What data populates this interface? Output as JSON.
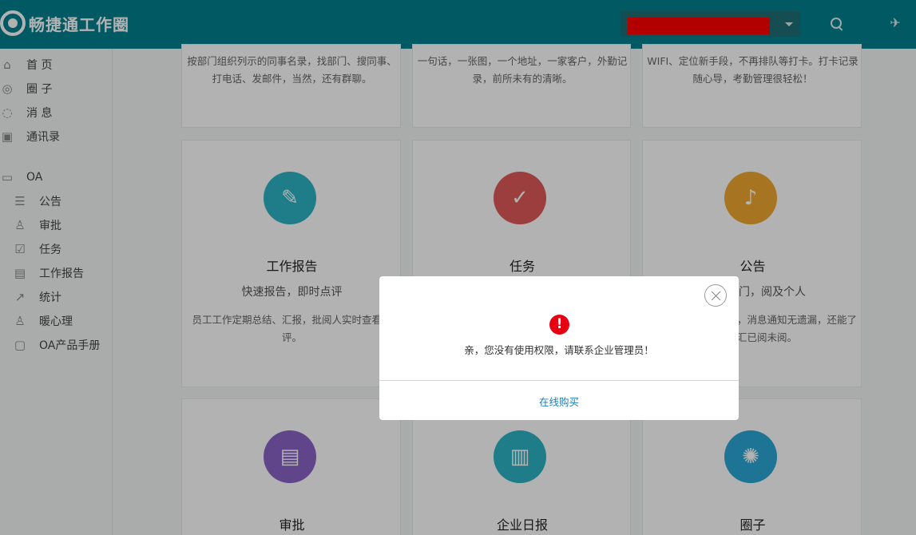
{
  "header": {
    "app_name": "畅捷通工作圈",
    "search_icon": "search-icon",
    "send_icon": "paper-plane-icon"
  },
  "sidebar": {
    "main": [
      {
        "label": "首 页",
        "icon": "home-icon"
      },
      {
        "label": "圈 子",
        "icon": "circle-icon"
      },
      {
        "label": "消 息",
        "icon": "chat-icon"
      },
      {
        "label": "通讯录",
        "icon": "contacts-icon"
      }
    ],
    "section": {
      "label": "OA",
      "icon": "monitor-icon"
    },
    "sub": [
      {
        "label": "公告",
        "icon": "announcement-icon"
      },
      {
        "label": "审批",
        "icon": "stamp-icon"
      },
      {
        "label": "任务",
        "icon": "checklist-icon"
      },
      {
        "label": "工作报告",
        "icon": "report-icon"
      },
      {
        "label": "统计",
        "icon": "chart-icon"
      },
      {
        "label": "暖心理",
        "icon": "care-icon"
      },
      {
        "label": "OA产品手册",
        "icon": "manual-icon"
      }
    ]
  },
  "cards_top": [
    {
      "desc_lines": [
        "按部门组织列示的同事名录，找部门、搜同事、",
        "打电话、发邮件，当然，还有群聊。"
      ]
    },
    {
      "desc_lines": [
        "一句话，一张图，一个地址，一家客户，外勤记",
        "录，前所未有的清晰。"
      ]
    },
    {
      "desc_lines": [
        "WIFI、定位新手段，不再排队等打卡。打卡记录",
        "随心导，考勤管理很轻松！"
      ]
    }
  ],
  "cards_mid": [
    {
      "title": "工作报告",
      "subtitle": "快速报告，即时点评",
      "desc_lines": [
        "员工工作定期总结、汇报，批阅人实时查看和",
        "评。"
      ],
      "color": "#2db3c4",
      "icon": "report-edit-icon"
    },
    {
      "title": "任务",
      "subtitle": "",
      "desc_lines": [],
      "color": "#e05a5a",
      "icon": "clipboard-check-icon"
    },
    {
      "title": "公告",
      "subtitle": "门，阅及个人",
      "desc_lines": [
        "，消息通知无遗漏，还能了",
        "汇已阅未阅。"
      ],
      "color": "#f0a830",
      "icon": "bell-icon"
    }
  ],
  "cards_bottom": [
    {
      "title": "审批",
      "color": "#8a63c8",
      "icon": "document-check-icon"
    },
    {
      "title": "企业日报",
      "color": "#2db3c4",
      "icon": "bar-chart-icon"
    },
    {
      "title": "圈子",
      "color": "#2aa6d4",
      "icon": "aperture-icon"
    }
  ],
  "modal": {
    "message": "亲，您没有使用权限，请联系企业管理员！",
    "action": "在线购买",
    "alert_glyph": "!"
  }
}
